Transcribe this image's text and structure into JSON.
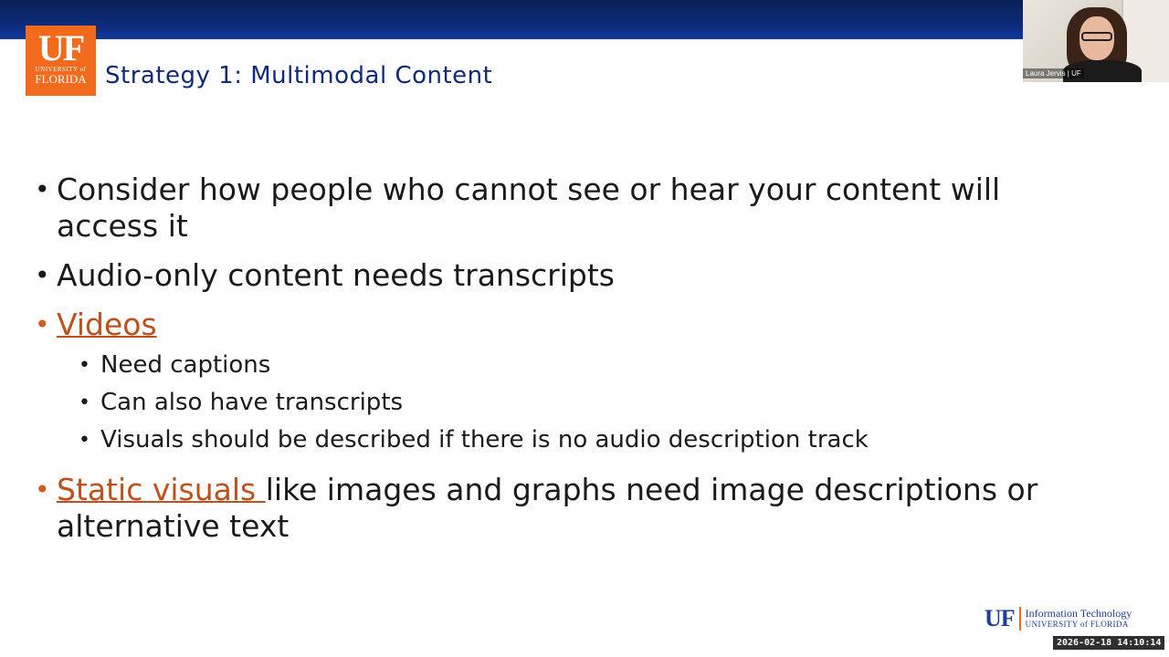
{
  "slide": {
    "title": "Strategy 1: Multimodal Content",
    "logo": {
      "line_top": "UF",
      "line_mid": "UNIVERSITY of",
      "line_bottom": "FLORIDA"
    },
    "bullets": {
      "b1": "Consider how people who cannot see or hear your content will access it",
      "b2": "Audio-only content needs transcripts",
      "b3_link": "Videos",
      "b3_sub": [
        "Need captions",
        "Can also have transcripts",
        "Visuals should be described if there is no audio description track"
      ],
      "b4_link": "Static visuals ",
      "b4_rest": "like images and graphs need image descriptions or alternative text"
    },
    "footer": {
      "uf": "UF",
      "line1": "Information Technology",
      "line2": "UNIVERSITY of FLORIDA"
    }
  },
  "video": {
    "participant_label": "Laura Jervis | UF"
  },
  "overlay": {
    "timestamp": "2026-02-18  14:10:14"
  },
  "colors": {
    "brand_blue": "#0f2a7a",
    "brand_orange": "#f26b1d",
    "link_orange": "#c0501b"
  }
}
